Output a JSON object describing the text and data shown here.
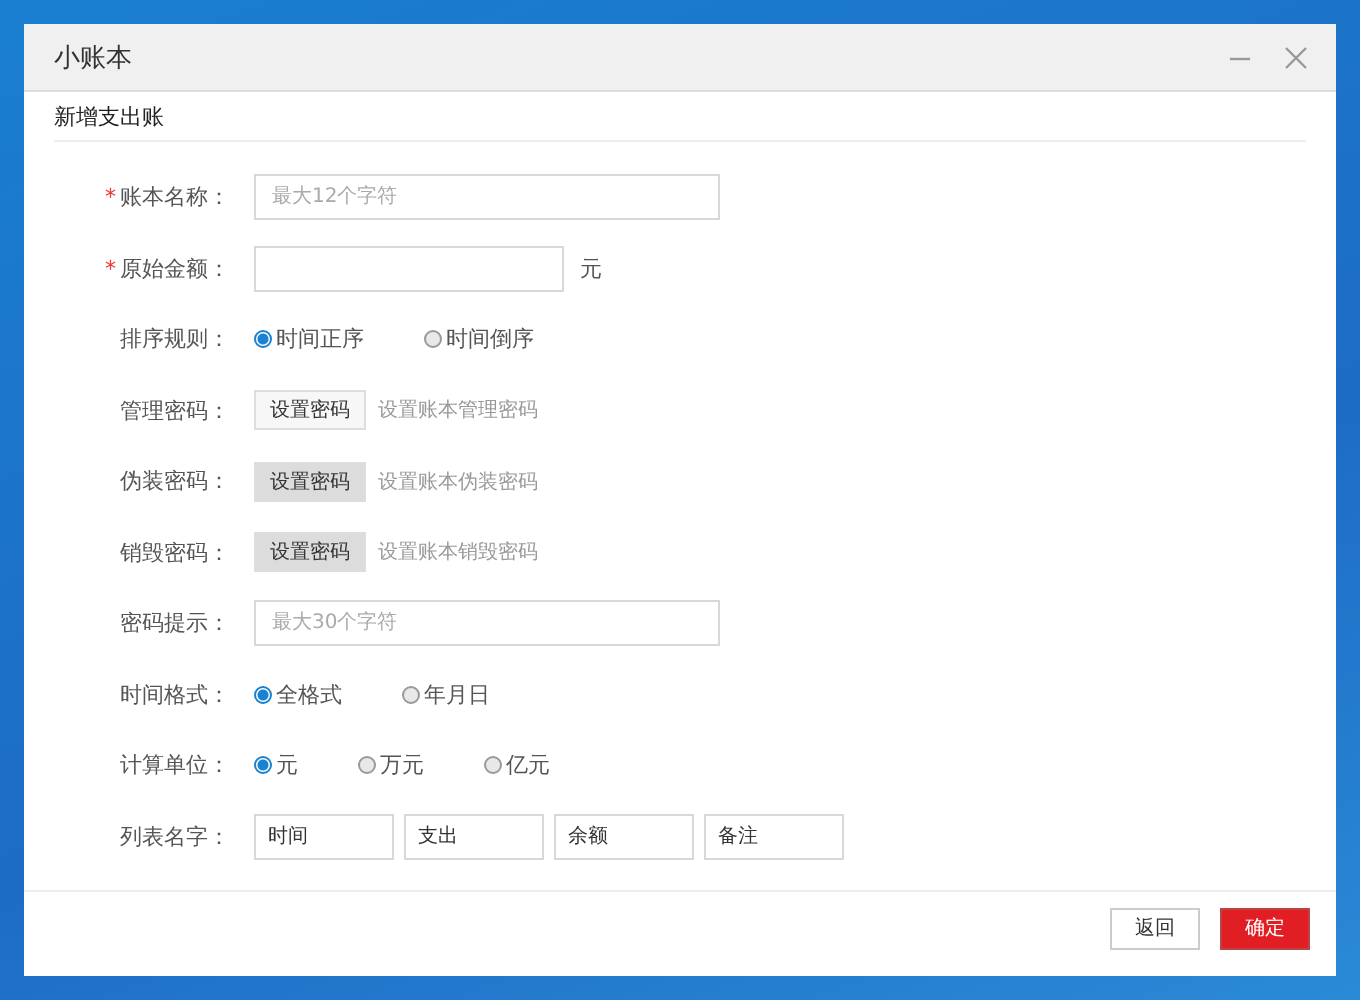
{
  "window": {
    "title": "小账本"
  },
  "section": "新增支出账",
  "rows": [
    {
      "kind": "text",
      "label": "账本名称：",
      "required_mark": "*",
      "placeholder": "最大12个字符"
    },
    {
      "kind": "text",
      "label": "原始金额：",
      "required_mark": "*",
      "suffix": "元"
    },
    {
      "kind": "radio",
      "label": "排序规则：",
      "options": [
        {
          "label": "时间正序",
          "selected": true
        },
        {
          "label": "时间倒序",
          "selected": false
        }
      ]
    },
    {
      "kind": "button",
      "label": "管理密码：",
      "button": "设置密码",
      "pressed": false,
      "hint": "设置账本管理密码"
    },
    {
      "kind": "button",
      "label": "伪装密码：",
      "button": "设置密码",
      "pressed": true,
      "hint": "设置账本伪装密码"
    },
    {
      "kind": "button",
      "label": "销毁密码：",
      "button": "设置密码",
      "pressed": true,
      "hint": "设置账本销毁密码"
    },
    {
      "kind": "text",
      "label": "密码提示：",
      "placeholder": "最大30个字符"
    },
    {
      "kind": "radio",
      "label": "时间格式：",
      "options": [
        {
          "label": "全格式",
          "selected": true
        },
        {
          "label": "年月日",
          "selected": false
        }
      ]
    },
    {
      "kind": "radio",
      "label": "计算单位：",
      "options": [
        {
          "label": "元",
          "selected": true
        },
        {
          "label": "万元",
          "selected": false
        },
        {
          "label": "亿元",
          "selected": false
        }
      ]
    },
    {
      "kind": "columns",
      "label": "列表名字：",
      "values": [
        "时间",
        "支出",
        "余额",
        "备注"
      ]
    }
  ],
  "buttons": [
    {
      "label": "返回",
      "primary": false
    },
    {
      "label": "确定",
      "primary": true
    }
  ]
}
